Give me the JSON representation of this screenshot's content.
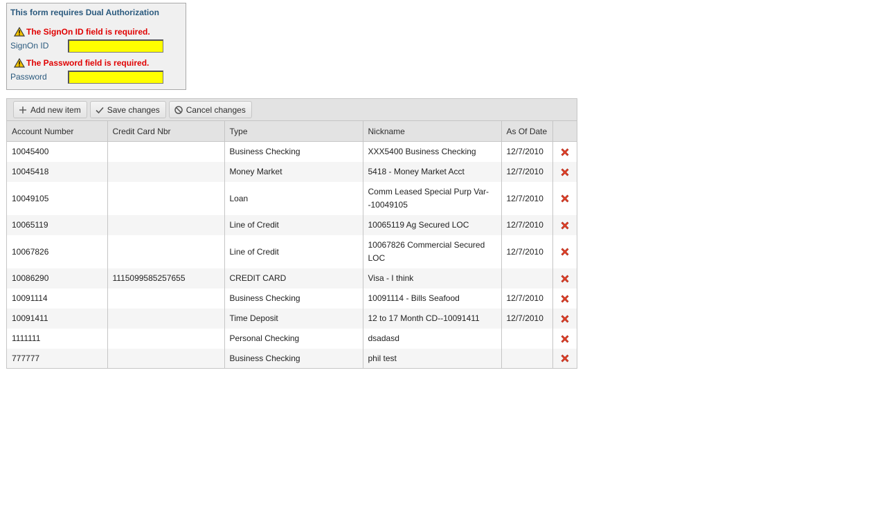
{
  "auth": {
    "title": "This form requires Dual Authorization",
    "signon_error": "The SignOn ID field is required.",
    "signon_label": "SignOn ID",
    "signon_value": "",
    "password_error": "The Password field is required.",
    "password_label": "Password",
    "password_value": "",
    "warning_icon": "warning-icon",
    "field_error_color": "#ffff00"
  },
  "toolbar": {
    "add_label": "Add new item",
    "save_label": "Save changes",
    "cancel_label": "Cancel changes"
  },
  "table": {
    "headers": [
      "Account Number",
      "Credit Card Nbr",
      "Type",
      "Nickname",
      "As Of Date",
      ""
    ],
    "rows": [
      {
        "account": "10045400",
        "card": "",
        "type": "Business Checking",
        "nickname": "XXX5400 Business Checking",
        "date": "12/7/2010"
      },
      {
        "account": "10045418",
        "card": "",
        "type": "Money Market",
        "nickname": "5418 - Money Market Acct",
        "date": "12/7/2010"
      },
      {
        "account": "10049105",
        "card": "",
        "type": "Loan",
        "nickname": "Comm Leased Special Purp Var--10049105",
        "date": "12/7/2010"
      },
      {
        "account": "10065119",
        "card": "",
        "type": "Line of Credit",
        "nickname": "10065119 Ag Secured LOC",
        "date": "12/7/2010"
      },
      {
        "account": "10067826",
        "card": "",
        "type": "Line of Credit",
        "nickname": "10067826 Commercial Secured LOC",
        "date": "12/7/2010"
      },
      {
        "account": "10086290",
        "card": "1115099585257655",
        "type": "CREDIT CARD",
        "nickname": "Visa - I think",
        "date": ""
      },
      {
        "account": "10091114",
        "card": "",
        "type": "Business Checking",
        "nickname": "10091114 - Bills Seafood",
        "date": "12/7/2010"
      },
      {
        "account": "10091411",
        "card": "",
        "type": "Time Deposit",
        "nickname": "12 to 17 Month CD--10091411",
        "date": "12/7/2010"
      },
      {
        "account": "1111111",
        "card": "",
        "type": "Personal Checking",
        "nickname": "dsadasd",
        "date": ""
      },
      {
        "account": "777777",
        "card": "",
        "type": "Business Checking",
        "nickname": "phil test",
        "date": ""
      }
    ],
    "delete_icon": "delete-x-icon"
  }
}
